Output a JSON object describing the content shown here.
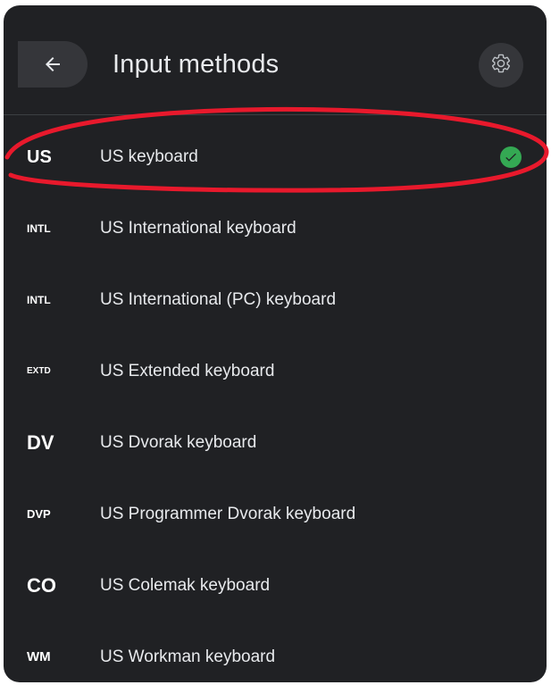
{
  "header": {
    "title": "Input methods",
    "back_icon": "arrow-left-icon",
    "settings_icon": "gear-icon"
  },
  "colors": {
    "panel_bg": "#202124",
    "text": "#e8eaed",
    "selected_check": "#34a853",
    "annotation_ring": "#e8192c"
  },
  "methods": [
    {
      "abbr": "US",
      "label": "US keyboard",
      "selected": true
    },
    {
      "abbr": "INTL",
      "label": "US International keyboard"
    },
    {
      "abbr": "INTL",
      "label": "US International (PC) keyboard"
    },
    {
      "abbr": "EXTD",
      "label": "US Extended keyboard"
    },
    {
      "abbr": "DV",
      "label": "US Dvorak keyboard"
    },
    {
      "abbr": "DVP",
      "label": "US Programmer Dvorak keyboard"
    },
    {
      "abbr": "CO",
      "label": "US Colemak keyboard"
    },
    {
      "abbr": "WM",
      "label": "US Workman keyboard"
    }
  ]
}
